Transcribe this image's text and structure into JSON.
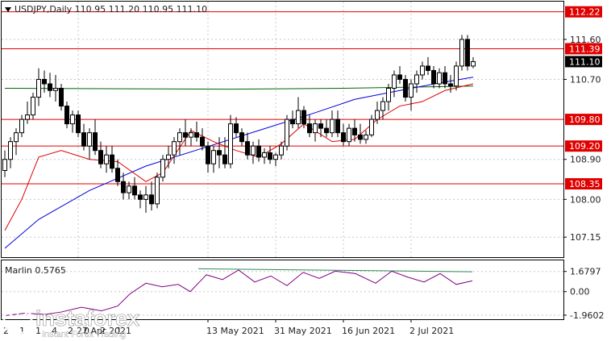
{
  "colors": {
    "background": "#ffffff",
    "frame": "#000000",
    "grid": "#c8c8c8",
    "level_line": "#e00000",
    "level_tag": "#e00000",
    "price_tag": "#000000",
    "ma_blue": "#0000dd",
    "ma_red": "#e00000",
    "ma_green": "#006400",
    "osc_purple": "#800080",
    "osc_teal": "#2e8b57"
  },
  "icons": {
    "header_marker": "triangle-down-icon",
    "watermark_logo": "instaforex-sunburst-logo"
  },
  "chart_data": [
    {
      "type": "candlestick",
      "header": "USDJPY,Daily  110.95 111.20 110.95 111.10",
      "ylim": [
        106.7,
        112.45
      ],
      "y_tick_values": [
        111.6,
        110.7,
        108.9,
        108.0,
        107.15
      ],
      "y_tick_labels": [
        "111.60",
        "110.70",
        "108.90",
        "108.00",
        "107.15"
      ],
      "levels": [
        {
          "value": 112.22,
          "label": "112.22"
        },
        {
          "value": 111.39,
          "label": "111.39"
        },
        {
          "value": 109.8,
          "label": "109.80"
        },
        {
          "value": 109.2,
          "label": "109.20"
        },
        {
          "value": 108.35,
          "label": "108.35"
        }
      ],
      "current_price": {
        "value": 111.1,
        "label": "111.10"
      },
      "x_ticks": [
        {
          "index": 13,
          "label": "27 Apr 2021"
        },
        {
          "index": 36,
          "label": "13 May 2021"
        },
        {
          "index": 48,
          "label": "31 May 2021"
        },
        {
          "index": 60,
          "label": "16 Jun 2021"
        },
        {
          "index": 72,
          "label": "2 Jul 2021"
        }
      ],
      "x_tick_labels_partial": [
        "2",
        "1",
        "1",
        "4",
        "2",
        "0",
        "2",
        "1"
      ],
      "ohlc": [
        [
          108.65,
          109.1,
          108.5,
          108.9
        ],
        [
          108.9,
          109.4,
          108.7,
          109.3
        ],
        [
          109.3,
          109.6,
          109.0,
          109.5
        ],
        [
          109.5,
          109.9,
          109.4,
          109.8
        ],
        [
          109.8,
          110.2,
          109.7,
          109.9
        ],
        [
          109.9,
          110.4,
          109.8,
          110.3
        ],
        [
          110.3,
          110.95,
          110.1,
          110.7
        ],
        [
          110.7,
          110.9,
          110.4,
          110.6
        ],
        [
          110.6,
          110.85,
          110.3,
          110.45
        ],
        [
          110.45,
          110.8,
          110.2,
          110.5
        ],
        [
          110.5,
          110.6,
          110.0,
          110.1
        ],
        [
          110.1,
          110.2,
          109.6,
          109.7
        ],
        [
          109.7,
          110.0,
          109.5,
          109.9
        ],
        [
          109.9,
          110.0,
          109.4,
          109.5
        ],
        [
          109.5,
          109.7,
          109.1,
          109.2
        ],
        [
          109.2,
          109.6,
          108.9,
          109.5
        ],
        [
          109.5,
          109.8,
          109.0,
          109.1
        ],
        [
          109.1,
          109.3,
          108.7,
          108.8
        ],
        [
          108.8,
          109.2,
          108.6,
          109.0
        ],
        [
          109.0,
          109.2,
          108.6,
          108.7
        ],
        [
          108.7,
          108.9,
          108.3,
          108.4
        ],
        [
          108.4,
          108.6,
          108.0,
          108.15
        ],
        [
          108.15,
          108.4,
          108.0,
          108.3
        ],
        [
          108.3,
          108.5,
          108.0,
          108.1
        ],
        [
          108.1,
          108.2,
          107.8,
          108.0
        ],
        [
          108.0,
          108.3,
          107.7,
          108.1
        ],
        [
          108.1,
          108.4,
          107.75,
          107.9
        ],
        [
          107.9,
          108.6,
          107.8,
          108.5
        ],
        [
          108.5,
          109.0,
          108.4,
          108.9
        ],
        [
          108.9,
          109.2,
          108.7,
          109.0
        ],
        [
          109.0,
          109.4,
          108.8,
          109.3
        ],
        [
          109.3,
          109.6,
          109.0,
          109.5
        ],
        [
          109.5,
          109.8,
          109.2,
          109.4
        ],
        [
          109.4,
          109.6,
          109.2,
          109.5
        ],
        [
          109.5,
          109.75,
          109.3,
          109.4
        ],
        [
          109.4,
          109.6,
          109.1,
          109.2
        ],
        [
          109.2,
          109.3,
          108.6,
          108.8
        ],
        [
          108.8,
          109.2,
          108.6,
          109.1
        ],
        [
          109.1,
          109.4,
          108.7,
          109.0
        ],
        [
          109.0,
          109.4,
          108.7,
          108.8
        ],
        [
          108.8,
          109.9,
          108.7,
          109.7
        ],
        [
          109.7,
          109.85,
          109.4,
          109.5
        ],
        [
          109.5,
          109.6,
          109.2,
          109.3
        ],
        [
          109.3,
          109.5,
          108.9,
          109.0
        ],
        [
          109.0,
          109.3,
          108.8,
          109.2
        ],
        [
          109.2,
          109.35,
          108.85,
          108.95
        ],
        [
          108.95,
          109.15,
          108.8,
          109.05
        ],
        [
          109.05,
          109.2,
          108.8,
          108.9
        ],
        [
          108.9,
          109.05,
          108.75,
          109.0
        ],
        [
          109.0,
          109.3,
          108.9,
          109.2
        ],
        [
          109.2,
          109.9,
          109.1,
          109.8
        ],
        [
          109.8,
          110.0,
          109.6,
          109.7
        ],
        [
          109.7,
          110.3,
          109.6,
          110.0
        ],
        [
          110.0,
          110.1,
          109.6,
          109.7
        ],
        [
          109.7,
          109.9,
          109.4,
          109.5
        ],
        [
          109.5,
          109.8,
          109.3,
          109.7
        ],
        [
          109.7,
          109.8,
          109.4,
          109.6
        ],
        [
          109.6,
          109.8,
          109.4,
          109.5
        ],
        [
          109.5,
          110.0,
          109.4,
          109.8
        ],
        [
          109.8,
          110.0,
          109.4,
          109.5
        ],
        [
          109.5,
          109.7,
          109.2,
          109.3
        ],
        [
          109.3,
          109.7,
          109.2,
          109.6
        ],
        [
          109.6,
          109.8,
          109.3,
          109.45
        ],
        [
          109.45,
          109.7,
          109.25,
          109.35
        ],
        [
          109.35,
          109.55,
          109.25,
          109.45
        ],
        [
          109.45,
          109.9,
          109.4,
          109.8
        ],
        [
          109.8,
          110.2,
          109.7,
          110.0
        ],
        [
          110.0,
          110.3,
          109.8,
          110.2
        ],
        [
          110.2,
          110.6,
          110.0,
          110.5
        ],
        [
          110.5,
          110.9,
          110.3,
          110.8
        ],
        [
          110.8,
          111.0,
          110.6,
          110.7
        ],
        [
          110.7,
          110.8,
          110.2,
          110.3
        ],
        [
          110.3,
          110.7,
          110.0,
          110.6
        ],
        [
          110.6,
          110.9,
          110.4,
          110.8
        ],
        [
          110.8,
          111.1,
          110.7,
          111.0
        ],
        [
          111.0,
          111.2,
          110.8,
          110.9
        ],
        [
          110.9,
          111.0,
          110.5,
          110.6
        ],
        [
          110.6,
          110.95,
          110.5,
          110.85
        ],
        [
          110.85,
          111.0,
          110.5,
          110.6
        ],
        [
          110.6,
          110.8,
          110.4,
          110.55
        ],
        [
          110.55,
          111.1,
          110.45,
          111.0
        ],
        [
          111.0,
          111.7,
          110.9,
          111.6
        ],
        [
          111.6,
          111.7,
          110.9,
          111.0
        ],
        [
          111.0,
          111.2,
          110.95,
          111.1
        ]
      ],
      "ma_blue": [
        [
          0,
          106.9
        ],
        [
          6,
          107.55
        ],
        [
          15,
          108.2
        ],
        [
          25,
          108.75
        ],
        [
          35,
          109.15
        ],
        [
          45,
          109.55
        ],
        [
          55,
          109.95
        ],
        [
          62,
          110.25
        ],
        [
          70,
          110.45
        ],
        [
          77,
          110.62
        ],
        [
          83,
          110.75
        ]
      ],
      "ma_red": [
        [
          0,
          107.3
        ],
        [
          3,
          108.0
        ],
        [
          6,
          108.95
        ],
        [
          10,
          109.1
        ],
        [
          15,
          108.9
        ],
        [
          20,
          108.85
        ],
        [
          25,
          108.4
        ],
        [
          28,
          108.6
        ],
        [
          33,
          109.55
        ],
        [
          37,
          109.3
        ],
        [
          41,
          109.1
        ],
        [
          45,
          108.95
        ],
        [
          49,
          109.25
        ],
        [
          53,
          109.7
        ],
        [
          58,
          109.3
        ],
        [
          62,
          109.35
        ],
        [
          66,
          109.8
        ],
        [
          70,
          110.1
        ],
        [
          74,
          110.2
        ],
        [
          78,
          110.45
        ],
        [
          83,
          110.6
        ]
      ],
      "ma_green": [
        [
          0,
          110.5
        ],
        [
          40,
          110.48
        ],
        [
          60,
          110.5
        ],
        [
          83,
          110.55
        ]
      ]
    },
    {
      "type": "line",
      "title": "Marlin 0.5765",
      "ylim": [
        -2.3,
        2.6
      ],
      "y_tick_values": [
        1.6797,
        0.0,
        -1.9602
      ],
      "y_tick_labels": [
        "1.6797",
        "0.00",
        "-1.9602"
      ],
      "series": [
        {
          "values": [
            [
              0,
              -2.0
            ],
            [
              5,
              -1.8
            ],
            [
              10,
              -1.9
            ],
            [
              14,
              -1.7
            ],
            [
              19,
              -1.3
            ],
            [
              24,
              -1.6
            ],
            [
              28,
              -1.2
            ],
            [
              31,
              -0.2
            ],
            [
              35,
              0.7
            ],
            [
              39,
              0.4
            ],
            [
              43,
              0.6
            ],
            [
              46,
              0.0
            ],
            [
              50,
              1.4
            ],
            [
              54,
              1.0
            ],
            [
              58,
              1.8
            ],
            [
              62,
              0.8
            ],
            [
              66,
              1.3
            ],
            [
              70,
              0.5
            ],
            [
              74,
              1.6
            ],
            [
              78,
              1.1
            ],
            [
              82,
              1.7
            ],
            [
              87,
              1.5
            ],
            [
              92,
              0.7
            ],
            [
              96,
              1.7
            ],
            [
              100,
              1.2
            ],
            [
              104,
              0.8
            ],
            [
              108,
              1.5
            ],
            [
              112,
              0.6
            ],
            [
              116,
              0.9
            ]
          ]
        },
        {
          "values": [
            [
              48,
              1.9
            ],
            [
              116,
              1.65
            ]
          ]
        }
      ]
    }
  ],
  "watermark": {
    "brand": "instaforex",
    "tagline": "Instant Forex Trading"
  }
}
